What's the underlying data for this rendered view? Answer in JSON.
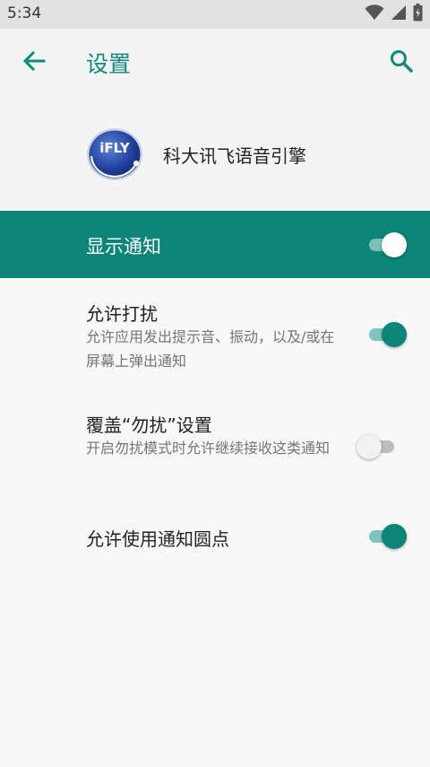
{
  "status_bar": {
    "time": "5:34"
  },
  "app_bar": {
    "title": "设置"
  },
  "app_header": {
    "logo_text": "iFLY",
    "name": "科大讯飞语音引擎"
  },
  "master": {
    "label": "显示通知",
    "on": true
  },
  "settings": [
    {
      "title": "允许打扰",
      "subtitle": "允许应用发出提示音、振动，以及/或在屏幕上弹出通知",
      "on": true
    },
    {
      "title": "覆盖“勿扰”设置",
      "subtitle": "开启勿扰模式时允许继续接收这类通知",
      "on": false
    },
    {
      "title": "允许使用通知圆点",
      "on": true
    }
  ],
  "colors": {
    "accent": "#0b8578",
    "title_accent": "#0f8a7e",
    "status_bar": "#e2e2e2"
  },
  "icons": [
    "wifi-icon",
    "cell-signal-icon",
    "battery-icon",
    "back-arrow-icon",
    "search-icon"
  ]
}
